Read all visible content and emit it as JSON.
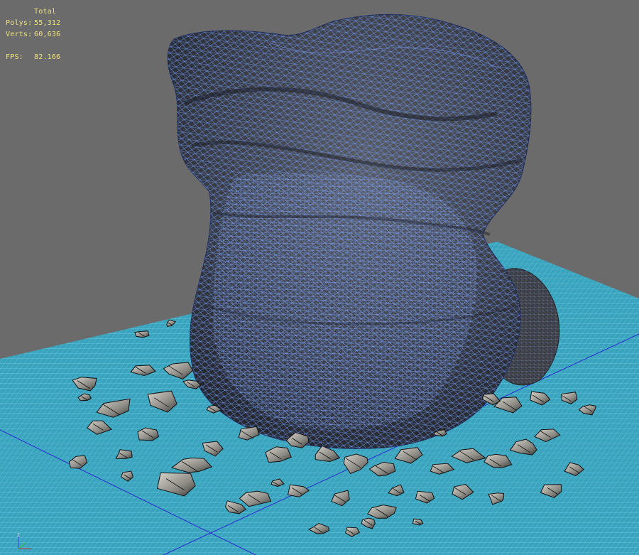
{
  "viewport": {
    "stats": {
      "title": "Total",
      "polys_label": "Polys:",
      "polys_value": "55,312",
      "verts_label": "Verts:",
      "verts_value": "60,636",
      "fps_label": "FPS:",
      "fps_value": "82.166"
    },
    "gizmo": {
      "z": "z",
      "x": "x",
      "y": "y"
    }
  },
  "colors": {
    "background": "#6b6b6b",
    "grid_plane": "#3aa8c4",
    "grid_lines": "#7fd6e8",
    "rock": "#3d3f45",
    "wireframe": "#4f7dff",
    "stats_text": "#f0e27a"
  }
}
